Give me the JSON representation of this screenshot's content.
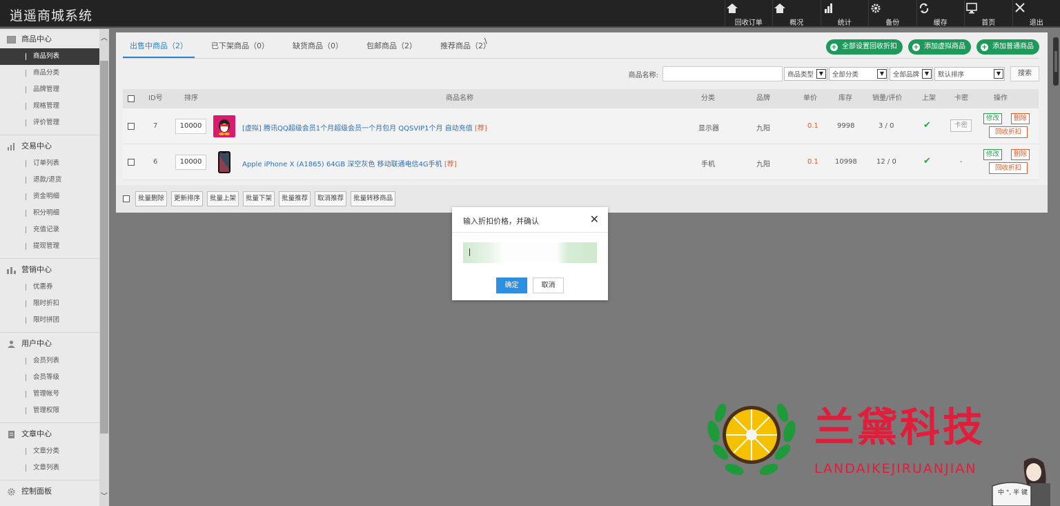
{
  "app": {
    "title": "逍遥商城系统"
  },
  "topnav": [
    {
      "label": "回收订单",
      "icon": "home-icon"
    },
    {
      "label": "概况",
      "icon": "home-icon"
    },
    {
      "label": "统计",
      "icon": "bar-chart-icon"
    },
    {
      "label": "备份",
      "icon": "gear-icon"
    },
    {
      "label": "缓存",
      "icon": "refresh-icon"
    },
    {
      "label": "首页",
      "icon": "monitor-icon"
    },
    {
      "label": "退出",
      "icon": "close-icon"
    }
  ],
  "sidebar": {
    "groups": [
      {
        "title": "商品中心",
        "icon": "image-icon",
        "items": [
          "商品列表",
          "商品分类",
          "品牌管理",
          "规格管理",
          "评价管理"
        ]
      },
      {
        "title": "交易中心",
        "icon": "bar-chart-icon",
        "items": [
          "订单列表",
          "退款/退货",
          "资金明细",
          "积分明细",
          "充值记录",
          "提现管理"
        ]
      },
      {
        "title": "营销中心",
        "icon": "chart-icon",
        "items": [
          "优惠券",
          "限时折扣",
          "限时拼团"
        ]
      },
      {
        "title": "用户中心",
        "icon": "user-icon",
        "items": [
          "会员列表",
          "会员等级",
          "管理帐号",
          "管理权限"
        ]
      },
      {
        "title": "文章中心",
        "icon": "document-icon",
        "items": [
          "文章分类",
          "文章列表"
        ]
      },
      {
        "title": "控制面板",
        "icon": "gear-icon",
        "items": []
      }
    ],
    "active": "商品列表"
  },
  "tabs": [
    {
      "label": "出售中商品（2）"
    },
    {
      "label": "已下架商品（0）"
    },
    {
      "label": "缺货商品（0）"
    },
    {
      "label": "包邮商品（2）"
    },
    {
      "label": "推荐商品（2）"
    }
  ],
  "tab_extra": "\\",
  "actions": {
    "set_recycle_discount": "全部设置回收折扣",
    "add_virtual": "添加虚拟商品",
    "add_normal": "添加普通商品"
  },
  "filters": {
    "name_label": "商品名称:",
    "type": "商品类型",
    "category": "全部分类",
    "brand": "全部品牌",
    "sort": "默认排序",
    "search": "搜索"
  },
  "table": {
    "headers": [
      "ID号",
      "排序",
      "商品名称",
      "分类",
      "品牌",
      "单价",
      "库存",
      "销量/评价",
      "上架",
      "卡密",
      "操作"
    ],
    "rows": [
      {
        "id": "7",
        "sort": "10000",
        "name": "[虚拟] 腾讯QQ超级会员1个月超级会员一个月包月 QQSVIP1个月 自动充值",
        "tag": "[荐]",
        "category": "显示器",
        "brand": "九阳",
        "price": "0.1",
        "stock": "9998",
        "sales": "3 / 0",
        "listed": "✔",
        "card": "卡密",
        "edit": "修改",
        "delete": "删除",
        "recycle": "回收折扣"
      },
      {
        "id": "6",
        "sort": "10000",
        "name": "Apple iPhone X (A1865) 64GB 深空灰色 移动联通电信4G手机",
        "tag": "[荐]",
        "category": "手机",
        "brand": "九阳",
        "price": "0.1",
        "stock": "10998",
        "sales": "12 / 0",
        "listed": "✔",
        "card": "-",
        "edit": "修改",
        "delete": "删除",
        "recycle": "回收折扣"
      }
    ]
  },
  "batch": [
    "批量删除",
    "更新排序",
    "批量上架",
    "批量下架",
    "批量推荐",
    "取消推荐",
    "批量转移商品"
  ],
  "modal": {
    "title": "输入折扣价格，并确认",
    "ok": "确定",
    "cancel": "取消"
  },
  "watermark": {
    "title": "兰黛科技",
    "subtitle": "LANDAIKEJIRUANJIAN",
    "bubble_text": "中 °, 半 键"
  },
  "colors": {
    "accent_blue": "#2d83c9",
    "green": "#1d9a5a",
    "orange": "#e05b2b",
    "watermark_red": "#e01d3b"
  }
}
